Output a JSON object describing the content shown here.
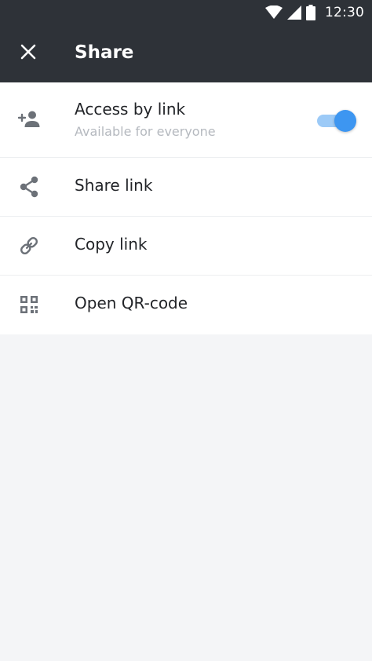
{
  "status_bar": {
    "time": "12:30",
    "icons": [
      "wifi-icon",
      "signal-icon",
      "battery-icon"
    ]
  },
  "toolbar": {
    "title": "Share",
    "close_icon": "close-icon"
  },
  "items": [
    {
      "label": "Access by link",
      "sublabel": "Available for everyone",
      "icon": "add-person-icon",
      "toggle_on": true
    },
    {
      "label": "Share link",
      "icon": "share-icon"
    },
    {
      "label": "Copy link",
      "icon": "link-icon"
    },
    {
      "label": "Open QR-code",
      "icon": "qr-code-icon"
    }
  ],
  "colors": {
    "appbar": "#2e3238",
    "accent": "#3d96f1",
    "background": "#f4f5f7"
  }
}
